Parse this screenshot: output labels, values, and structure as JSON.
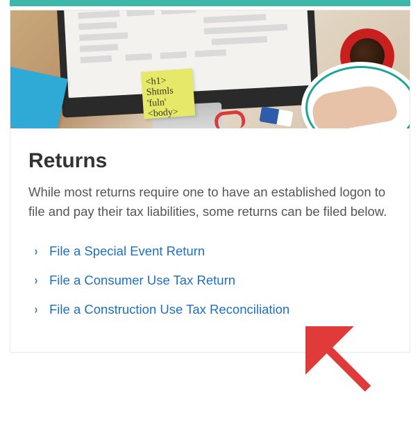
{
  "card": {
    "title": "Returns",
    "description": "While most returns require one to have an established logon to file and pay their tax liabilities, some returns can be filed below.",
    "links": [
      {
        "label": "File a Special Event Return"
      },
      {
        "label": "File a Consumer Use Tax Return"
      },
      {
        "label": "File a Construction Use Tax Reconciliation"
      }
    ]
  },
  "hero": {
    "sticky_note_text": "<h1>\nShtmls 'fuln'\n<body>"
  }
}
